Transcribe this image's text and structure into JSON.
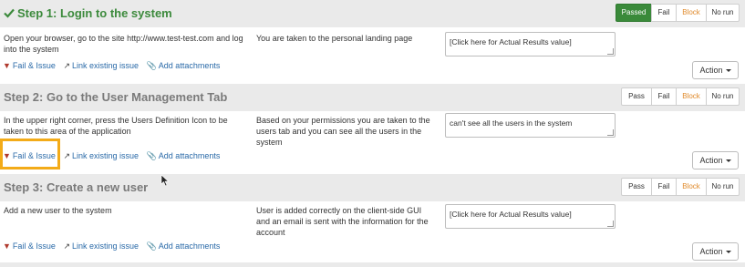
{
  "steps": [
    {
      "title": "Step 1: Login to the system",
      "status_buttons": [
        "Passed",
        "Fail",
        "Block",
        "No run"
      ],
      "active_status": "Passed",
      "description": "Open your browser, go to the site http://www.test-test.com and log into the system",
      "expected": "You are taken to the personal landing page",
      "actual": "[Click here for Actual Results value]",
      "links": {
        "fail_issue": "Fail & Issue",
        "link_existing": "Link existing issue",
        "add_attachments": "Add attachments"
      },
      "action": "Action"
    },
    {
      "title": "Step 2: Go to the User Management Tab",
      "status_buttons": [
        "Pass",
        "Fail",
        "Block",
        "No run"
      ],
      "active_status": "",
      "description": "In the upper right corner, press the Users Definition Icon to be taken to this area of the application",
      "expected": "Based on your permissions you are taken to the users tab and you can see all the users in the system",
      "actual": "can't see all the users in the system",
      "links": {
        "fail_issue": "Fail & Issue",
        "link_existing": "Link existing issue",
        "add_attachments": "Add attachments"
      },
      "action": "Action"
    },
    {
      "title": "Step 3: Create a new user",
      "status_buttons": [
        "Pass",
        "Fail",
        "Block",
        "No run"
      ],
      "active_status": "",
      "description": "Add a new user to the system",
      "expected": "User is added correctly on the client-side GUI and an email is sent with the information for the account",
      "actual": "[Click here for Actual Results value]",
      "links": {
        "fail_issue": "Fail & Issue",
        "link_existing": "Link existing issue",
        "add_attachments": "Add attachments"
      },
      "action": "Action"
    }
  ],
  "colors": {
    "passed": "#3a8a3a",
    "block_text": "#e08b2d",
    "link": "#2a6aa8",
    "highlight": "#f3ab18",
    "header_bg": "#eaeaea"
  },
  "icons": {
    "check": "check-icon",
    "thumbs_down": "thumbs-down-icon",
    "external_link": "external-link-icon",
    "paperclip": "paperclip-icon",
    "caret": "caret-down-icon"
  }
}
